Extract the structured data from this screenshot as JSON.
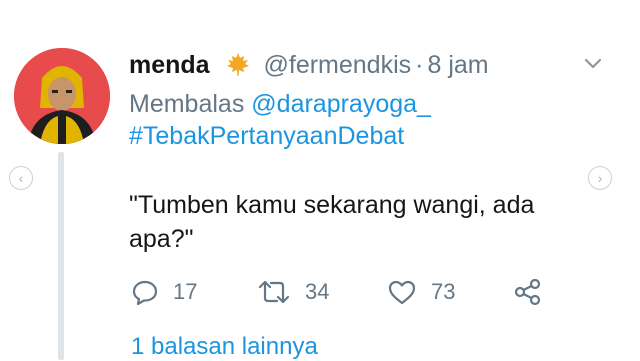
{
  "tweet": {
    "display_name": "menda",
    "badge_icon": "maple-leaf-icon",
    "handle": "@fermendkis",
    "separator": "·",
    "time": "8 jam",
    "reply_prefix": "Membalas",
    "reply_to": "@daraprayoga_",
    "hashtag": "#TebakPertanyaanDebat",
    "text": "\"Tumben kamu sekarang wangi, ada apa?\""
  },
  "actions": {
    "reply_count": "17",
    "retweet_count": "34",
    "like_count": "73"
  },
  "more_replies_label": "1 balasan lainnya",
  "colors": {
    "link": "#1b95e0",
    "muted": "#657786",
    "badge": "#f5a623",
    "avatar_bg": "#e84b4b"
  }
}
